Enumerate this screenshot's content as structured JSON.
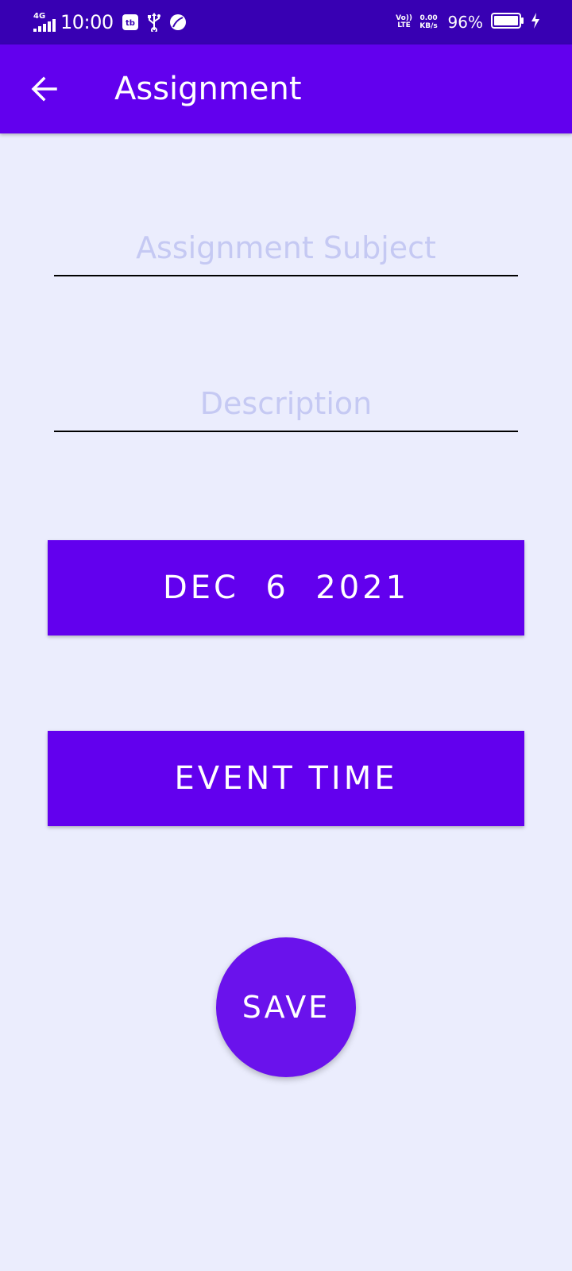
{
  "status_bar": {
    "network": "4G",
    "time": "10:00",
    "volte_top": "Vo))",
    "volte_bottom": "LTE",
    "speed_value": "0.00",
    "speed_unit": "KB/s",
    "battery_percent": "96%",
    "icons": [
      "signal-icon",
      "sim-app-icon",
      "usb-icon",
      "leaf-icon",
      "battery-icon",
      "charging-icon"
    ]
  },
  "app_bar": {
    "title": "Assignment",
    "back_icon": "arrow-back-icon"
  },
  "form": {
    "subject_placeholder": "Assignment Subject",
    "subject_value": "",
    "description_placeholder": "Description",
    "description_value": "",
    "date_label": "DEC  6  2021",
    "time_label": "EVENT TIME",
    "save_label": "SAVE"
  },
  "colors": {
    "status_bar": "#3800B3",
    "primary": "#6200EE",
    "background": "#EBEDFD",
    "placeholder": "#C5C9F3"
  }
}
